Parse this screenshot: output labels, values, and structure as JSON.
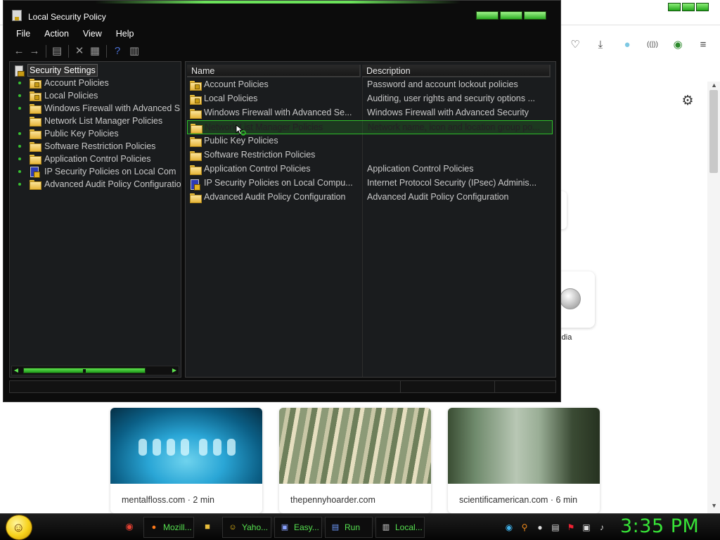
{
  "lsp": {
    "title": "Local Security Policy",
    "menu": [
      "File",
      "Action",
      "View",
      "Help"
    ],
    "tree": {
      "root": "Security Settings",
      "items": [
        {
          "label": "Account Policies",
          "icon": "folder-lock-icon",
          "expandable": true
        },
        {
          "label": "Local Policies",
          "icon": "folder-lock-icon",
          "expandable": true
        },
        {
          "label": "Windows Firewall with Advanced S",
          "icon": "folder-icon",
          "expandable": true
        },
        {
          "label": "Network List Manager Policies",
          "icon": "folder-icon",
          "expandable": false
        },
        {
          "label": "Public Key Policies",
          "icon": "folder-icon",
          "expandable": true
        },
        {
          "label": "Software Restriction Policies",
          "icon": "folder-icon",
          "expandable": true
        },
        {
          "label": "Application Control Policies",
          "icon": "folder-icon",
          "expandable": true
        },
        {
          "label": "IP Security Policies on Local Com",
          "icon": "shield-icon",
          "expandable": true
        },
        {
          "label": "Advanced Audit Policy Configuratio",
          "icon": "folder-icon",
          "expandable": true
        }
      ]
    },
    "list": {
      "columns": [
        "Name",
        "Description"
      ],
      "rows": [
        {
          "name": "Account Policies",
          "description": "Password and account lockout policies",
          "icon": "folder-lock-icon"
        },
        {
          "name": "Local Policies",
          "description": "Auditing, user rights and security options ...",
          "icon": "folder-lock-icon"
        },
        {
          "name": "Windows Firewall with Advanced Se...",
          "description": "Windows Firewall with Advanced Security",
          "icon": "folder-icon"
        },
        {
          "name": "Network List Manager Policies",
          "description": "Network name, icon and location group po...",
          "icon": "folder-icon",
          "selected": true
        },
        {
          "name": "Public Key Policies",
          "description": "",
          "icon": "folder-icon"
        },
        {
          "name": "Software Restriction Policies",
          "description": "",
          "icon": "folder-icon"
        },
        {
          "name": "Application Control Policies",
          "description": "Application Control Policies",
          "icon": "folder-icon"
        },
        {
          "name": "IP Security Policies on Local Compu...",
          "description": "Internet Protocol Security (IPsec) Adminis...",
          "icon": "shield-icon"
        },
        {
          "name": "Advanced Audit Policy Configuration",
          "description": "Advanced Audit Policy Configuration",
          "icon": "folder-icon"
        }
      ]
    }
  },
  "browser": {
    "shortcut_label": "ipedia",
    "stories": [
      {
        "source": "mentalfloss.com · 2 min",
        "image": "dental-xray-image"
      },
      {
        "source": "thepennyhoarder.com",
        "image": "money-stacks-image"
      },
      {
        "source": "scientificamerican.com · 6 min",
        "image": "foggy-forest-image"
      }
    ]
  },
  "taskbar": {
    "buttons": [
      {
        "label": "Mozill...",
        "icon": "firefox-icon"
      },
      {
        "label": "Yaho...",
        "icon": "yahoo-messenger-icon"
      },
      {
        "label": "Easy...",
        "icon": "program-icon"
      },
      {
        "label": "Run",
        "icon": "run-icon"
      },
      {
        "label": "Local...",
        "icon": "security-policy-icon"
      }
    ],
    "clock": "3:35 PM"
  },
  "colors": {
    "accent_green": "#37e437",
    "window_bg": "#1a1c1e",
    "folder_yellow": "#e7b63a"
  }
}
